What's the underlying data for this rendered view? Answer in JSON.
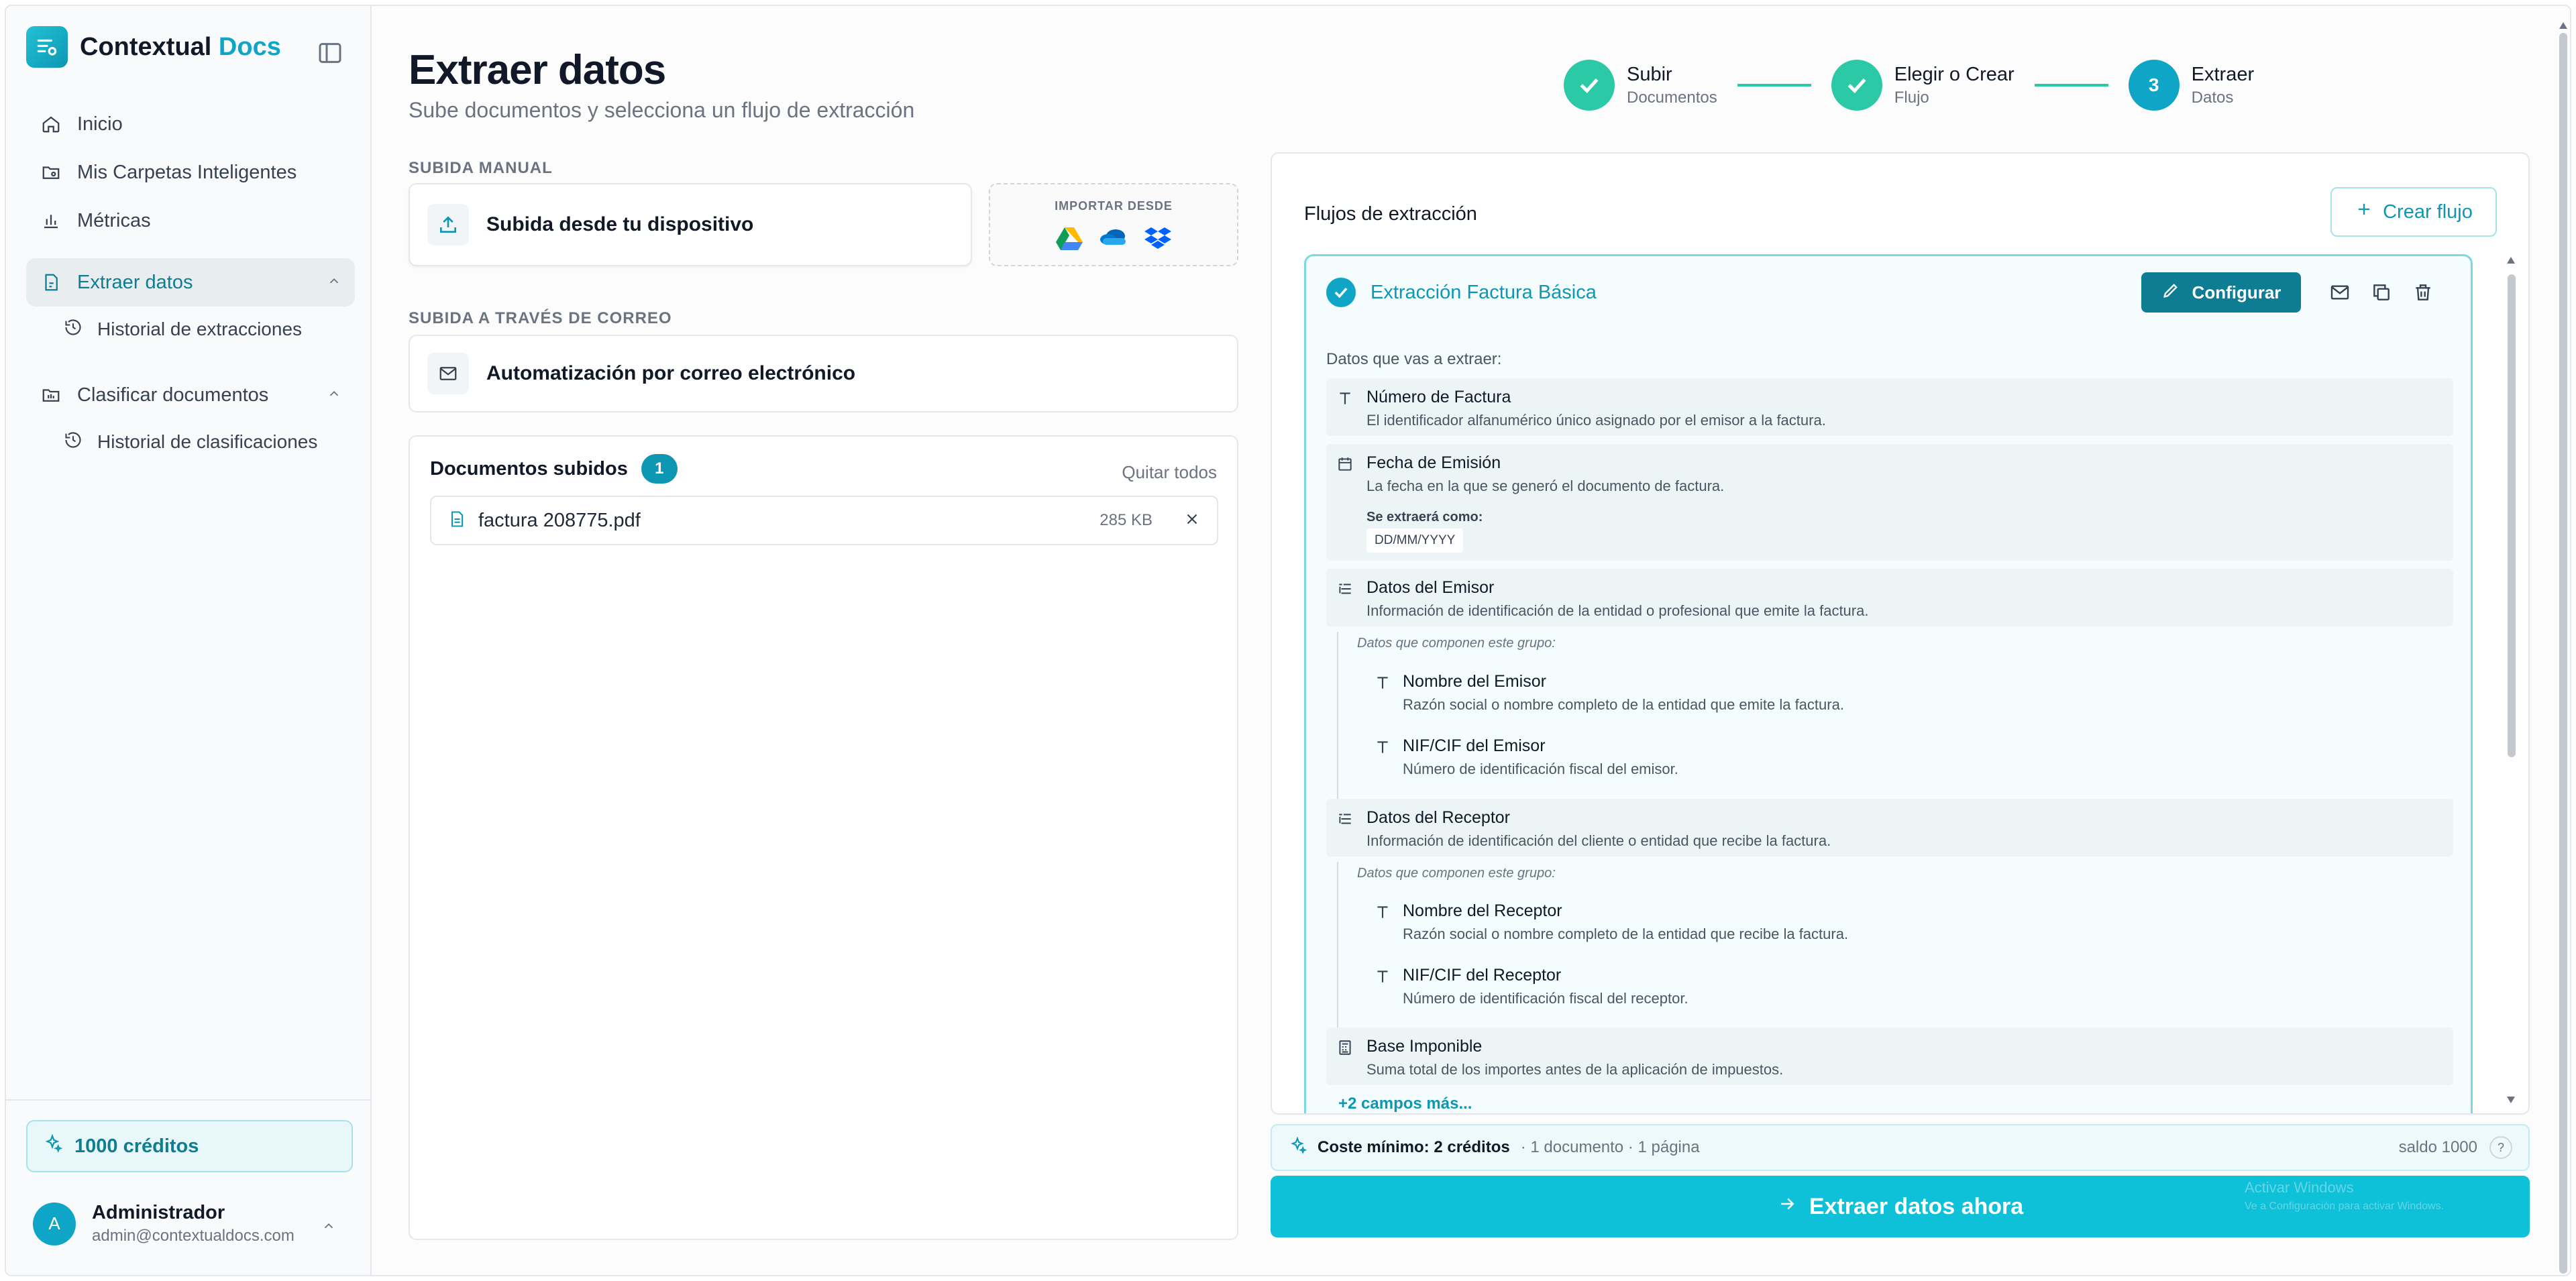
{
  "brand": {
    "name": "Contextual",
    "accent": "Docs"
  },
  "sidebar": {
    "items": [
      {
        "label": "Inicio",
        "icon": "home-icon"
      },
      {
        "label": "Mis Carpetas Inteligentes",
        "icon": "folder-icon"
      },
      {
        "label": "Métricas",
        "icon": "bar-chart-icon"
      },
      {
        "label": "Extraer datos",
        "icon": "file-extract-icon",
        "active": true
      },
      {
        "label": "Historial de extracciones",
        "icon": "history-icon"
      },
      {
        "label": "Clasificar documentos",
        "icon": "classify-icon"
      },
      {
        "label": "Historial de clasificaciones",
        "icon": "history-icon"
      }
    ],
    "credits": "1000 créditos",
    "user": {
      "initial": "A",
      "name": "Administrador",
      "email": "admin@contextualdocs.com"
    }
  },
  "page": {
    "title": "Extraer datos",
    "subtitle": "Sube documentos y selecciona un flujo de extracción"
  },
  "stepper": [
    {
      "title": "Subir",
      "sub": "Documentos",
      "state": "done"
    },
    {
      "title": "Elegir o Crear",
      "sub": "Flujo",
      "state": "done"
    },
    {
      "number": "3",
      "title": "Extraer",
      "sub": "Datos",
      "state": "current"
    }
  ],
  "upload": {
    "manual_label": "SUBIDA MANUAL",
    "device_label": "Subida desde tu dispositivo",
    "import_label": "IMPORTAR DESDE",
    "import_sources": [
      "google-drive-icon",
      "onedrive-icon",
      "dropbox-icon"
    ],
    "email_section_label": "SUBIDA A TRAVÉS DE CORREO",
    "email_label": "Automatización por correo electrónico"
  },
  "docs": {
    "title": "Documentos subidos",
    "count": "1",
    "remove_all": "Quitar todos",
    "files": [
      {
        "name": "factura 208775.pdf",
        "size": "285 KB"
      }
    ]
  },
  "flows": {
    "title": "Flujos de extracción",
    "create_label": "Crear flujo",
    "flow": {
      "name": "Extracción Factura Básica",
      "configure_label": "Configurar",
      "fields_label": "Datos que vas a extraer:",
      "fields": [
        {
          "name": "Número de Factura",
          "desc": "El identificador alfanumérico único asignado por el emisor a la factura.",
          "icon": "text-type-icon"
        },
        {
          "name": "Fecha de Emisión",
          "desc": "La fecha en la que se generó el documento de factura.",
          "icon": "calendar-icon",
          "extract_as": "Se extraerá como:",
          "format": "DD/MM/YYYY"
        },
        {
          "name": "Datos del Emisor",
          "desc": "Información de identificación de la entidad o profesional que emite la factura.",
          "icon": "group-list-icon",
          "group_label": "Datos que componen este grupo:",
          "children": [
            {
              "name": "Nombre del Emisor",
              "desc": "Razón social o nombre completo de la entidad que emite la factura."
            },
            {
              "name": "NIF/CIF del Emisor",
              "desc": "Número de identificación fiscal del emisor."
            }
          ]
        },
        {
          "name": "Datos del Receptor",
          "desc": "Información de identificación del cliente o entidad que recibe la factura.",
          "icon": "group-list-icon",
          "group_label": "Datos que componen este grupo:",
          "children": [
            {
              "name": "Nombre del Receptor",
              "desc": "Razón social o nombre completo de la entidad que recibe la factura."
            },
            {
              "name": "NIF/CIF del Receptor",
              "desc": "Número de identificación fiscal del receptor."
            }
          ]
        },
        {
          "name": "Base Imponible",
          "desc": "Suma total de los importes antes de la aplicación de impuestos.",
          "icon": "calculator-icon"
        }
      ],
      "more_fields": "+2 campos más..."
    }
  },
  "cost": {
    "label": "Coste mínimo: 2 créditos",
    "details": "· 1 documento · 1 página",
    "balance": "saldo 1000",
    "help": "?"
  },
  "extract_button": "Extraer datos ahora",
  "watermark": {
    "title": "Activar Windows",
    "sub": "Ve a Configuración para activar Windows."
  },
  "colors": {
    "accent": "#0ea5c6",
    "success": "#2cc9a7",
    "primary_dark": "#0e7d93"
  }
}
